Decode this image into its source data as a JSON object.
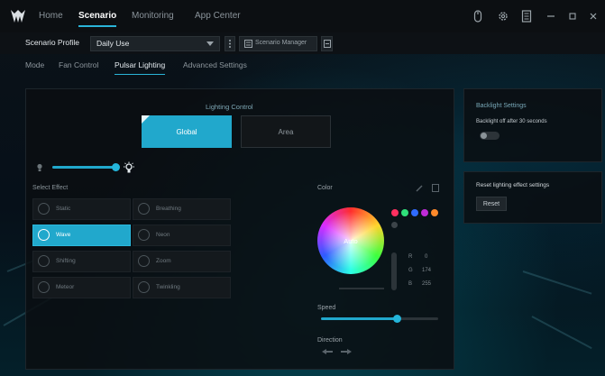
{
  "nav": {
    "home": "Home",
    "scenario": "Scenario",
    "monitoring": "Monitoring",
    "app_center": "App Center"
  },
  "profile": {
    "label": "Scenario Profile",
    "selected": "Daily Use",
    "manager_label": "Scenario Manager"
  },
  "subtabs": {
    "mode": "Mode",
    "fan_control": "Fan Control",
    "pulsar_lighting": "Pulsar Lighting",
    "advanced_settings": "Advanced Settings"
  },
  "lighting": {
    "title": "Lighting Control",
    "global": "Global",
    "area": "Area",
    "brightness_percent": 100,
    "select_effect_label": "Select Effect",
    "effects": [
      {
        "label": "Static",
        "active": false
      },
      {
        "label": "Breathing",
        "active": false
      },
      {
        "label": "Wave",
        "active": true
      },
      {
        "label": "Neon",
        "active": false
      },
      {
        "label": "Shifting",
        "active": false
      },
      {
        "label": "Zoom",
        "active": false
      },
      {
        "label": "Meteor",
        "active": false
      },
      {
        "label": "Twinkling",
        "active": false
      }
    ],
    "color_label": "Color",
    "wheel_label": "Auto",
    "r_label": "R",
    "r_value": "0",
    "g_label": "G",
    "g_value": "174",
    "b_label": "B",
    "b_value": "255",
    "speed_label": "Speed",
    "speed_percent": 65,
    "direction_label": "Direction",
    "presets": [
      "#ff3060",
      "#2fe07a",
      "#2f6bff",
      "#c02bd8",
      "#ff8a2b"
    ]
  },
  "backlight": {
    "title": "Backlight Settings",
    "text": "Backlight off after 30 seconds",
    "toggle_on": false
  },
  "reset": {
    "title": "Reset lighting effect settings",
    "button": "Reset"
  },
  "colors": {
    "accent": "#21a8cc",
    "background": "#05080b"
  }
}
